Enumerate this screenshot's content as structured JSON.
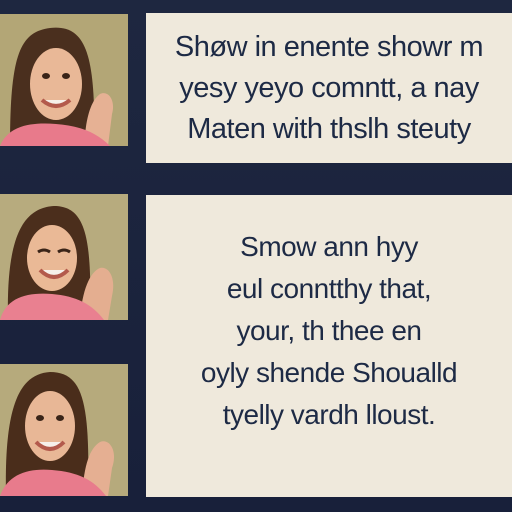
{
  "top_caption": {
    "lines": [
      "Shøw in enente showr m",
      "yesy yeyo comntt, a nay",
      "Maten with thslh steuty"
    ]
  },
  "bottom_caption": {
    "lines": [
      "Smow ann hyy",
      "eul conntthy that,",
      "your, th thee en",
      "oyly shende Shoualld",
      "tyelly vardh lloust."
    ]
  },
  "colors": {
    "background": "#1b2336",
    "panel": "#efe9dc",
    "text": "#1d2a45"
  },
  "icons": [
    "person-photo-1",
    "person-photo-2",
    "person-photo-3"
  ]
}
